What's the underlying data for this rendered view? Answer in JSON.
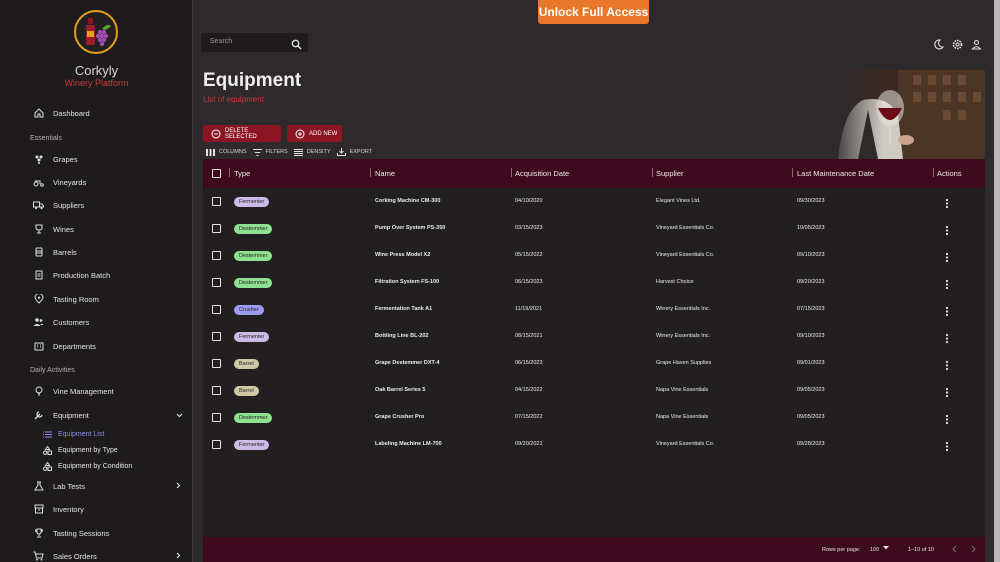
{
  "app": {
    "name": "Corkyly",
    "subtitle": "Winery Platform"
  },
  "banner": {
    "unlock_label": "Unlock Full Access"
  },
  "search": {
    "placeholder": "Search"
  },
  "sidebar": {
    "dashboard": "Dashboard",
    "section_essentials": "Essentials",
    "essentials": [
      "Grapes",
      "Vineyards",
      "Suppliers",
      "Wines",
      "Barrels",
      "Production Batch",
      "Tasting Room",
      "Customers",
      "Departments"
    ],
    "section_daily": "Daily Activities",
    "vine_management": "Vine Management",
    "equipment": "Equipment",
    "equipment_sub": [
      "Equipment List",
      "Equipment by Type",
      "Equipment by Condition"
    ],
    "lab_tests": "Lab Tests",
    "inventory": "Inventory",
    "tasting_sessions": "Tasting Sessions",
    "sales_orders": "Sales Orders"
  },
  "page": {
    "title": "Equipment",
    "subtitle": "List of equipment"
  },
  "actions": {
    "delete_selected": "DELETE SELECTED",
    "add_new": "ADD NEW"
  },
  "toolbar": {
    "columns": "COLUMNS",
    "filters": "FILTERS",
    "density": "DENSITY",
    "export": "EXPORT"
  },
  "table": {
    "headers": [
      "Type",
      "Name",
      "Acquisition Date",
      "Supplier",
      "Last Maintenance Date",
      "Actions"
    ],
    "rows": [
      {
        "type": "Fermenter",
        "name": "Corking Machine CM-300",
        "acq": "04/10/2020",
        "supplier": "Elegant Vines Ltd.",
        "maint": "09/30/2023"
      },
      {
        "type": "Destemmer",
        "name": "Pump Over System PS-350",
        "acq": "03/15/2023",
        "supplier": "Vineyard Essentials Co.",
        "maint": "10/05/2023"
      },
      {
        "type": "Destemmer",
        "name": "Wine Press Model X2",
        "acq": "05/15/2022",
        "supplier": "Vineyard Essentials Co.",
        "maint": "09/10/2023"
      },
      {
        "type": "Destemmer",
        "name": "Filtration System FS-100",
        "acq": "06/15/2023",
        "supplier": "Harvest Choice",
        "maint": "09/20/2023"
      },
      {
        "type": "Crusher",
        "name": "Fermentation Tank A1",
        "acq": "11/19/2021",
        "supplier": "Winery Essentials Inc.",
        "maint": "07/15/2023"
      },
      {
        "type": "Fermenter",
        "name": "Bottling Line BL-202",
        "acq": "08/15/2021",
        "supplier": "Winery Essentials Inc.",
        "maint": "09/10/2023"
      },
      {
        "type": "Barrel",
        "name": "Grape Destemmer DXT-4",
        "acq": "06/15/2023",
        "supplier": "Grape Haven Supplies",
        "maint": "09/01/2023"
      },
      {
        "type": "Barrel",
        "name": "Oak Barrel Series 5",
        "acq": "04/15/2022",
        "supplier": "Napa Vine Essentials",
        "maint": "09/05/2023"
      },
      {
        "type": "Destemmer",
        "name": "Grape Crusher Pro",
        "acq": "07/15/2022",
        "supplier": "Napa Vine Essentials",
        "maint": "09/05/2023"
      },
      {
        "type": "Fermenter",
        "name": "Labeling Machine LM-700",
        "acq": "09/20/2021",
        "supplier": "Vineyard Essentials Co.",
        "maint": "09/28/2023"
      }
    ],
    "chip_colors": {
      "Fermenter": "#cbbbe6",
      "Destemmer": "#8fe08f",
      "Crusher": "#9b9bf2",
      "Barrel": "#cfc9a6"
    }
  },
  "footer": {
    "rows_per_page_label": "Rows per page:",
    "rows_per_page": "100",
    "range": "1–10 of 10"
  }
}
